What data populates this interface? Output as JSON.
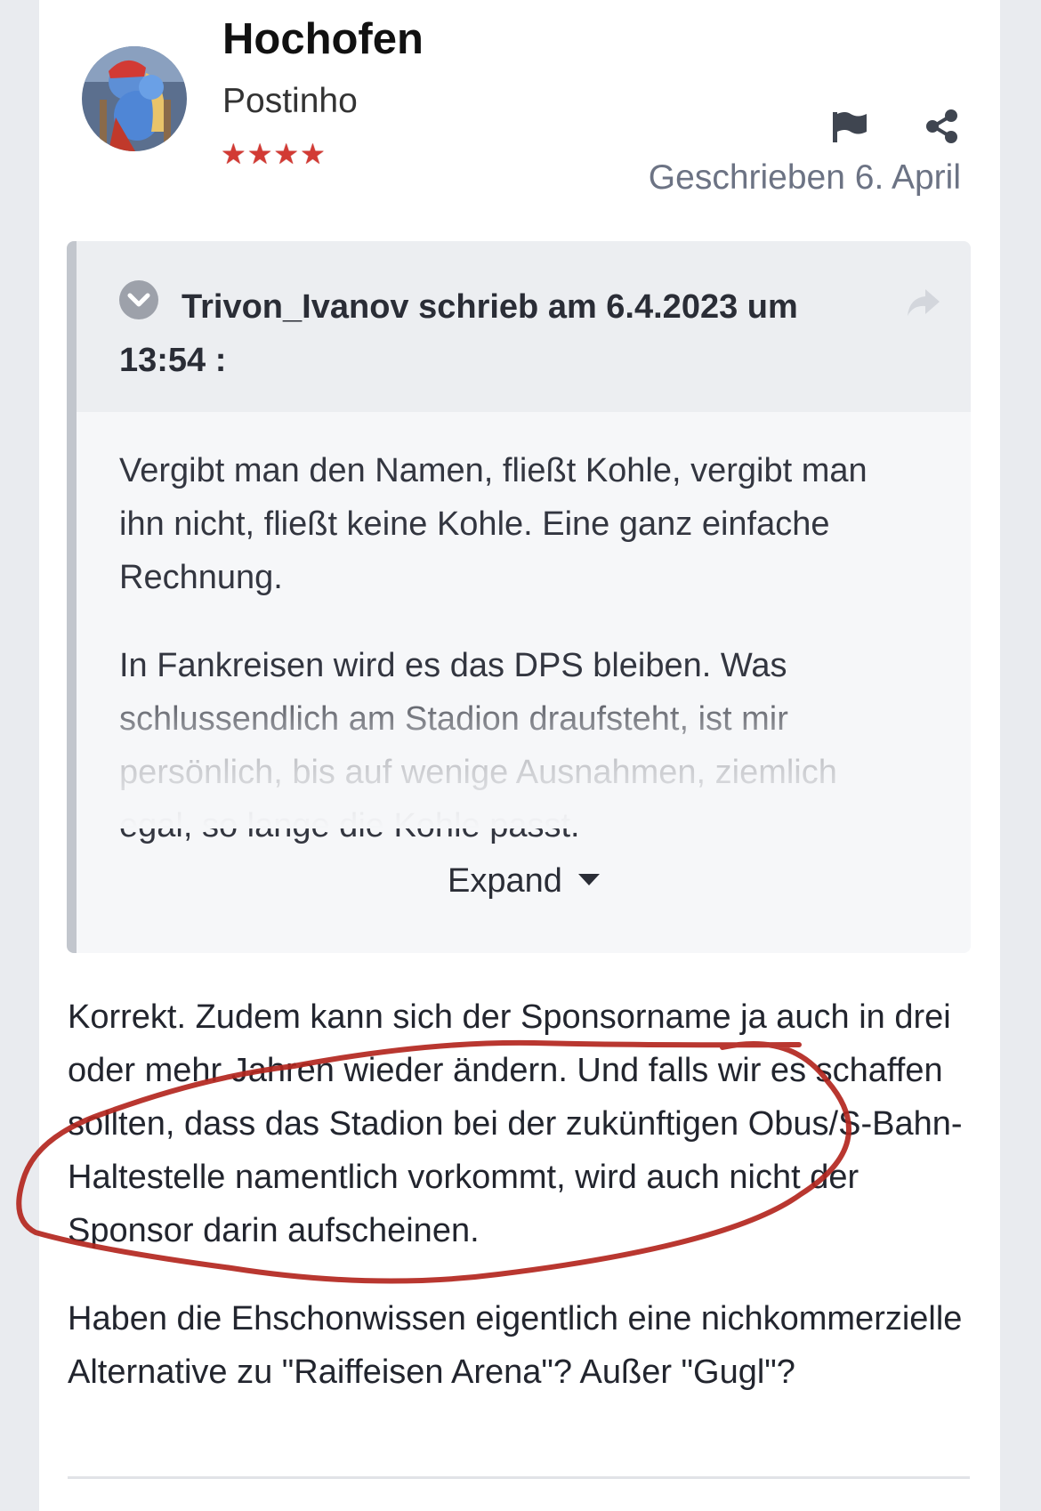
{
  "author": {
    "name": "Hochofen",
    "group": "Postinho",
    "rank_stars": "★★★★"
  },
  "post": {
    "date": "Geschrieben 6. April"
  },
  "quote": {
    "author_line": "Trivon_Ivanov schrieb am 6.4.2023 um 13:54 :",
    "paragraphs": [
      "Vergibt man den Namen, fließt Kohle, vergibt man ihn nicht, fließt keine Kohle. Eine ganz einfache Rechnung.",
      "In Fankreisen wird es das DPS bleiben. Was schlussendlich am Stadion draufsteht, ist mir persönlich, bis auf wenige Ausnahmen, ziemlich egal, so lange die Kohle passt."
    ],
    "expand_label": "Expand"
  },
  "content": {
    "paragraphs": [
      "Korrekt. Zudem kann sich der Sponsorname ja auch in drei oder mehr Jahren wieder ändern. Und falls wir es schaffen sollten, dass das Stadion bei der zukünftigen Obus/S-Bahn-Haltestelle namentlich vorkommt, wird auch nicht der Sponsor darin aufscheinen.",
      "Haben die Ehschonwissen eigentlich eine nichkommerzielle Alternative zu \"Raiffeisen Arena\"? Außer \"Gugl\"?"
    ]
  },
  "icons": {
    "flag": "flag-icon",
    "share": "share-icon",
    "collapse": "chevron-down-circle-icon",
    "quote_share": "share-arrow-icon"
  },
  "colors": {
    "accent_text": "#6c7384",
    "stars": "#d23a34",
    "scribble": "#b3261e"
  }
}
